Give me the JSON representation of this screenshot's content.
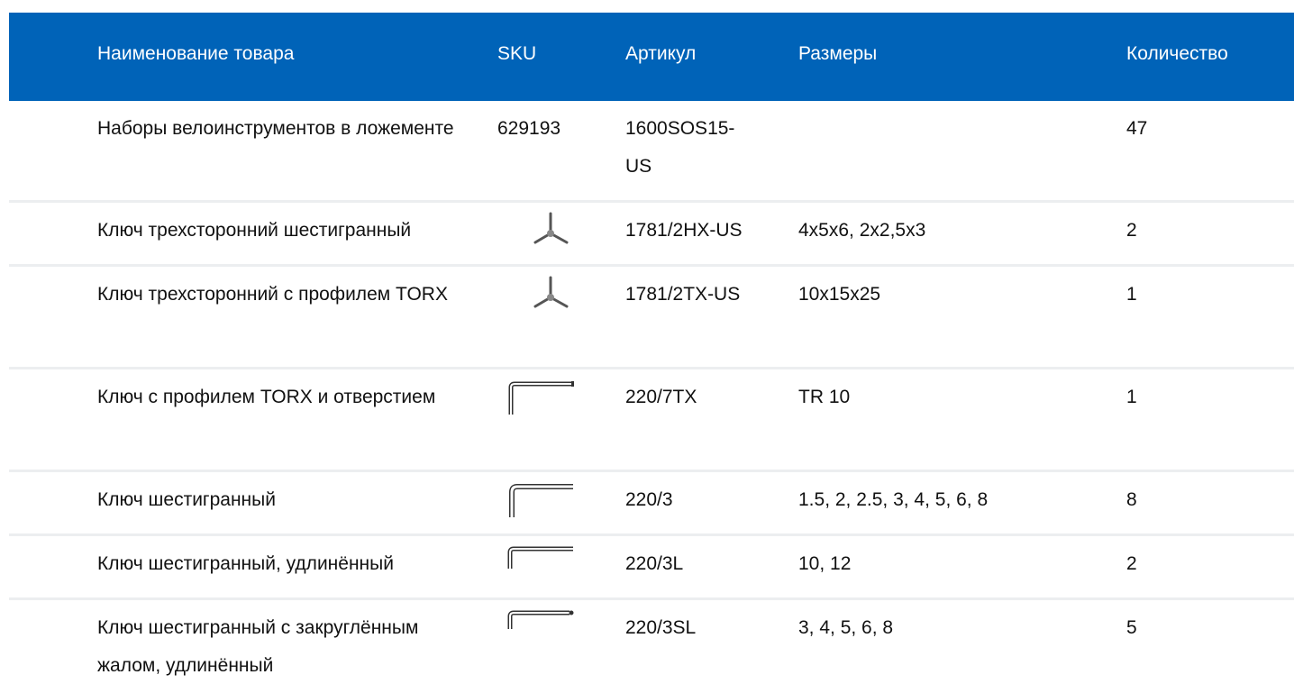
{
  "headers": {
    "name": "Наименование товара",
    "sku": "SKU",
    "article": "Артикул",
    "sizes": "Размеры",
    "qty": "Количество"
  },
  "rows": [
    {
      "name": "Наборы велоинструментов в ложементе",
      "sku": "629193",
      "sku_icon": "",
      "article": "1600SOS15-US",
      "sizes": "",
      "qty": "47"
    },
    {
      "name": "Ключ трехсторонний шестигранный",
      "sku": "",
      "sku_icon": "y-wrench-icon",
      "article": "1781/2HX-US",
      "sizes": "4x5x6, 2x2,5x3",
      "qty": "2"
    },
    {
      "name": "Ключ трехсторонний с профилем TORX",
      "sku": "",
      "sku_icon": "y-wrench-icon",
      "article": "1781/2TX-US",
      "sizes": "10x15x25",
      "qty": "1"
    },
    {
      "name": "Ключ с профилем TORX и отверстием",
      "sku": "",
      "sku_icon": "l-key-torx-icon",
      "article": "220/7TX",
      "sizes": "TR 10",
      "qty": "1"
    },
    {
      "name": "Ключ шестигранный",
      "sku": "",
      "sku_icon": "l-key-icon",
      "article": "220/3",
      "sizes": "1.5, 2, 2.5, 3, 4, 5, 6, 8",
      "qty": "8"
    },
    {
      "name": "Ключ шестигранный, удлинённый",
      "sku": "",
      "sku_icon": "l-key-long-icon",
      "article": "220/3L",
      "sizes": "10, 12",
      "qty": "2"
    },
    {
      "name": "Ключ шестигранный с закруглённым жалом, удлинённый",
      "sku": "",
      "sku_icon": "l-key-ball-icon",
      "article": "220/3SL",
      "sizes": "3, 4, 5, 6, 8",
      "qty": "5"
    }
  ],
  "colors": {
    "header_bg": "#0063b8",
    "header_text": "#ffffff",
    "row_divider": "#eceef0",
    "text": "#111111"
  }
}
